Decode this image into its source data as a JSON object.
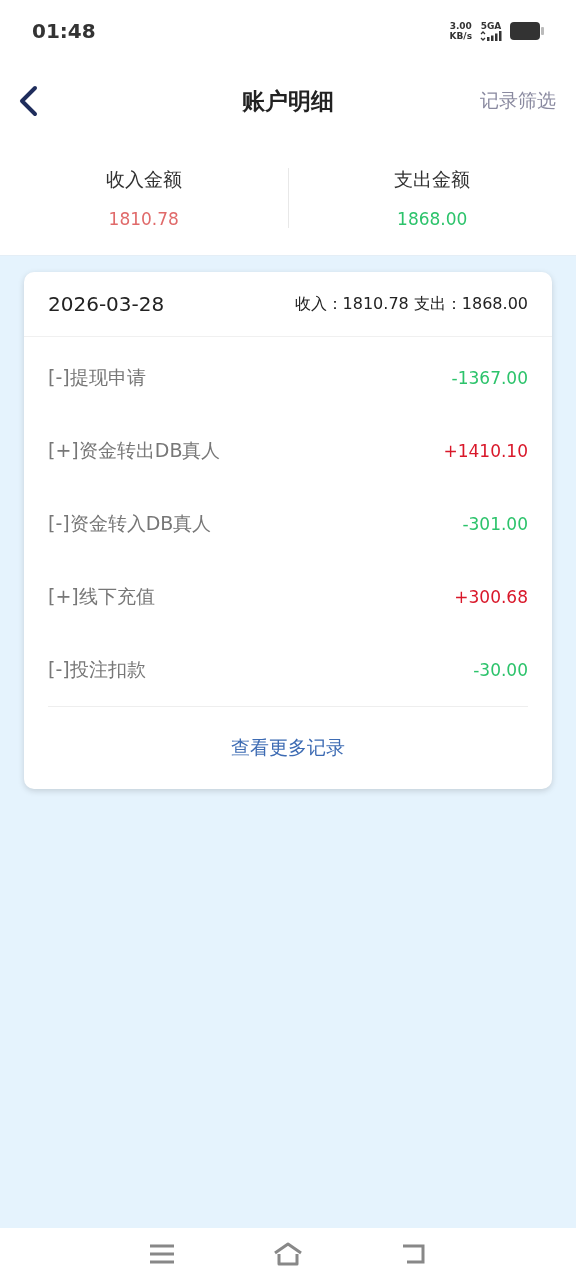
{
  "status_bar": {
    "time": "01:48",
    "speed": "3.00",
    "speed_unit": "KB/s",
    "network": "5GA"
  },
  "header": {
    "title": "账户明细",
    "action": "记录筛选"
  },
  "summary": [
    {
      "label": "收入金额",
      "value": "1810.78",
      "kind": "income"
    },
    {
      "label": "支出金额",
      "value": "1868.00",
      "kind": "expense"
    }
  ],
  "day": {
    "date": "2026-03-28",
    "totals": "收入：1810.78 支出：1868.00",
    "records": [
      {
        "label": "[-]提现申请",
        "amount": "-1367.00",
        "kind": "expense"
      },
      {
        "label": "[+]资金转出DB真人",
        "amount": "+1410.10",
        "kind": "income"
      },
      {
        "label": "[-]资金转入DB真人",
        "amount": "-301.00",
        "kind": "expense"
      },
      {
        "label": "[+]线下充值",
        "amount": "+300.68",
        "kind": "income"
      },
      {
        "label": "[-]投注扣款",
        "amount": "-30.00",
        "kind": "expense"
      }
    ],
    "more": "查看更多记录"
  }
}
